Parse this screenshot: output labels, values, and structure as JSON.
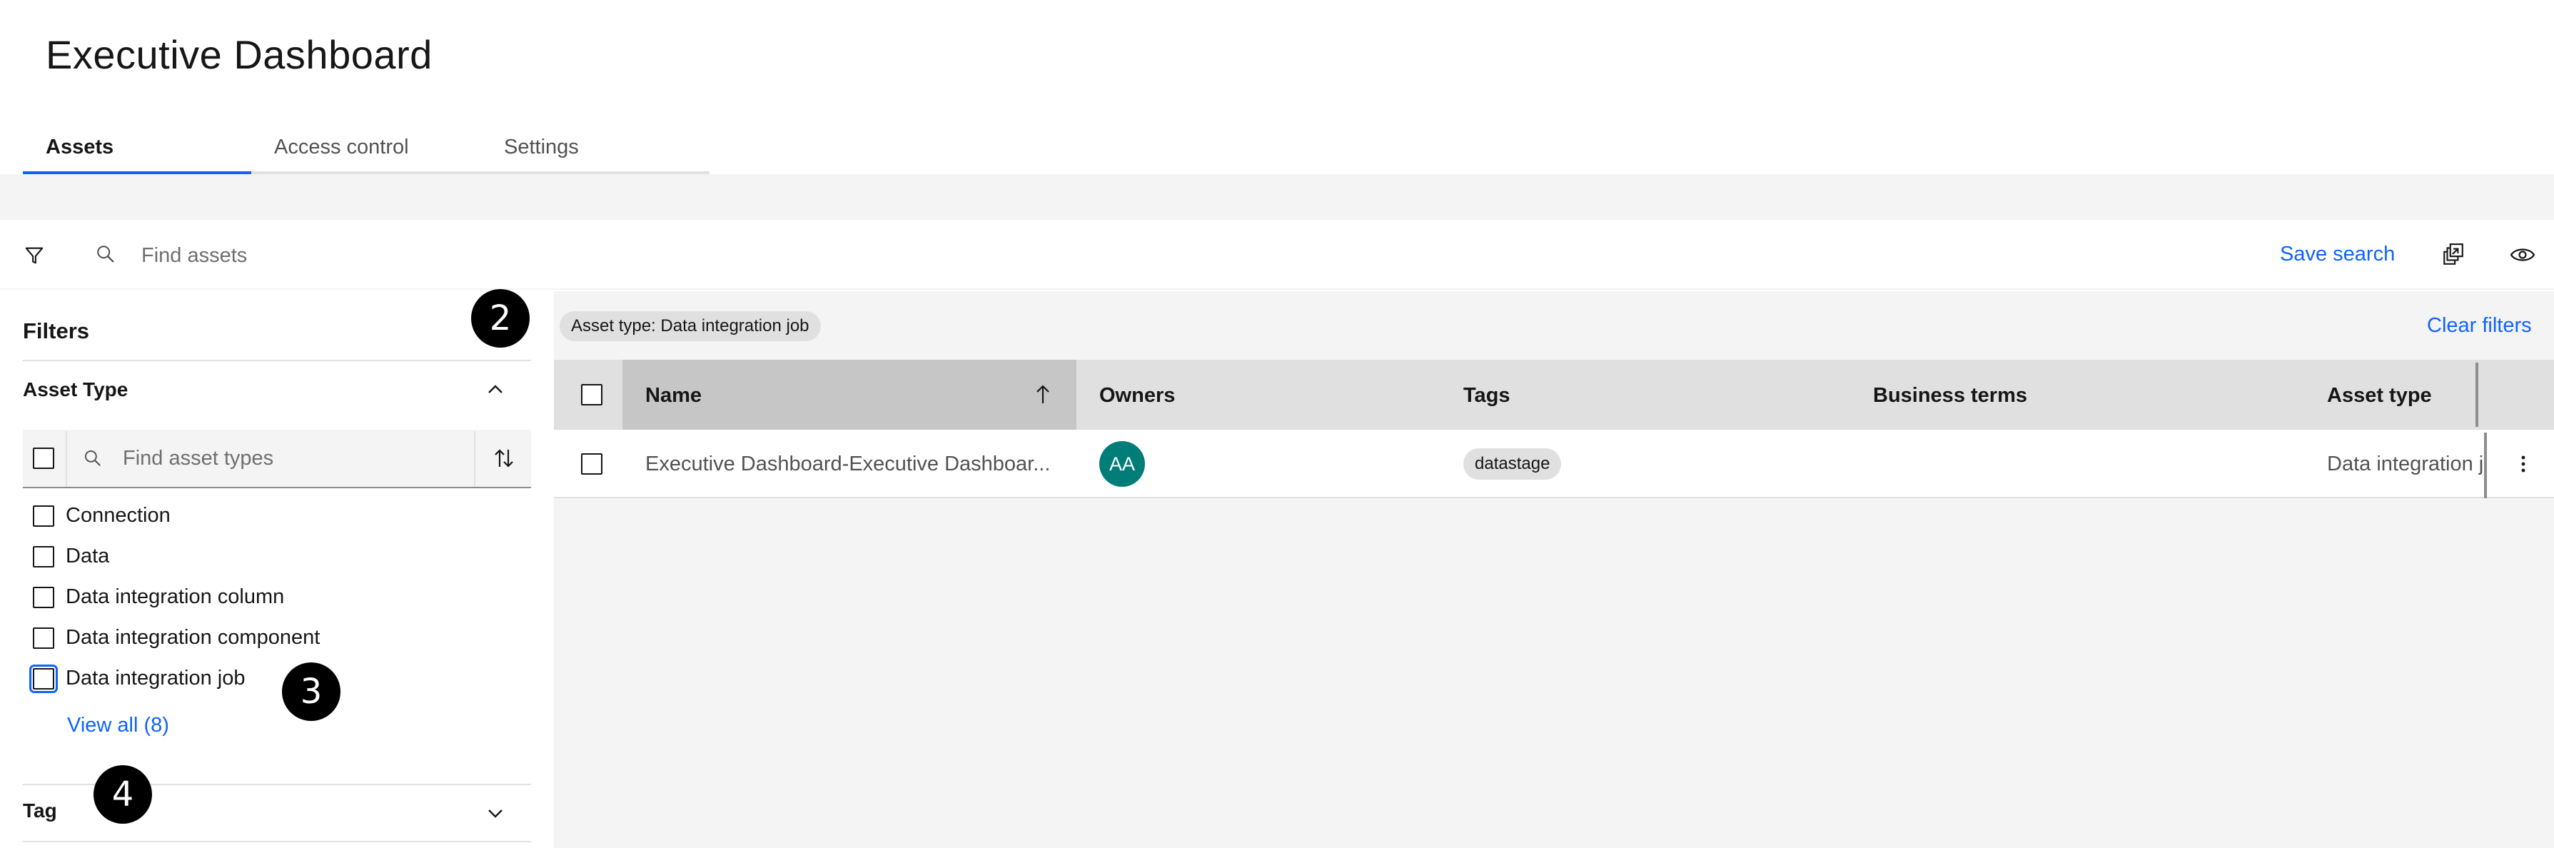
{
  "page": {
    "title": "Executive Dashboard"
  },
  "tabs": [
    {
      "label": "Assets",
      "active": true
    },
    {
      "label": "Access control",
      "active": false
    },
    {
      "label": "Settings",
      "active": false
    }
  ],
  "toolbar": {
    "search_placeholder": "Find assets",
    "save_search_label": "Save search"
  },
  "filters": {
    "title": "Filters",
    "asset_type": {
      "heading": "Asset Type",
      "search_placeholder": "Find asset types",
      "options": [
        {
          "label": "Connection",
          "checked": false
        },
        {
          "label": "Data",
          "checked": false
        },
        {
          "label": "Data integration column",
          "checked": false
        },
        {
          "label": "Data integration component",
          "checked": false
        },
        {
          "label": "Data integration job",
          "checked": false,
          "focused": true
        }
      ],
      "view_all_label": "View all (8)"
    },
    "tag": {
      "heading": "Tag"
    }
  },
  "callouts": [
    "2",
    "3",
    "4"
  ],
  "active_filters": {
    "chips": [
      "Asset type: Data integration job"
    ],
    "clear_label": "Clear filters"
  },
  "table": {
    "columns": [
      "Name",
      "Owners",
      "Tags",
      "Business terms",
      "Asset type"
    ],
    "sorted_column": "Name",
    "sort_direction": "ascending",
    "rows": [
      {
        "name": "Executive Dashboard-Executive Dashboar...",
        "owner_initials": "AA",
        "tags": [
          "datastage"
        ],
        "business_terms": "",
        "asset_type": "Data integration job"
      }
    ]
  },
  "colors": {
    "accent": "#0f62fe",
    "avatar": "#007d79",
    "panel_bg": "#f4f4f4",
    "header_bg": "#e0e0e0"
  }
}
